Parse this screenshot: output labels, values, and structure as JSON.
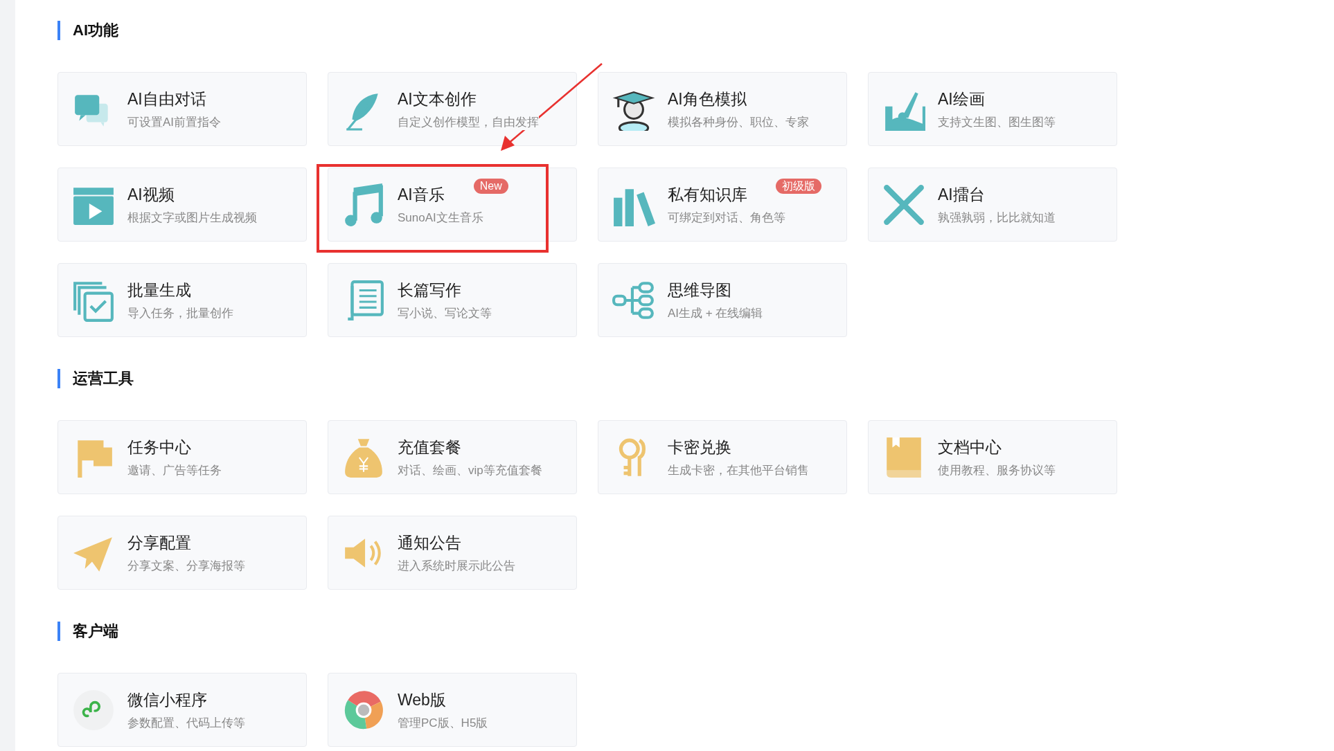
{
  "sections": [
    {
      "title": "AI功能",
      "items": [
        {
          "title": "AI自由对话",
          "desc": "可设置AI前置指令",
          "highlighted": false
        },
        {
          "title": "AI文本创作",
          "desc": "自定义创作模型，自由发挥",
          "highlighted": false
        },
        {
          "title": "AI角色模拟",
          "desc": "模拟各种身份、职位、专家",
          "highlighted": false
        },
        {
          "title": "AI绘画",
          "desc": "支持文生图、图生图等",
          "highlighted": false
        },
        {
          "title": "AI视频",
          "desc": "根据文字或图片生成视频",
          "highlighted": false
        },
        {
          "title": "AI音乐",
          "desc": "SunoAI文生音乐",
          "badge": "New",
          "highlighted": true
        },
        {
          "title": "私有知识库",
          "desc": "可绑定到对话、角色等",
          "badge": "初级版",
          "highlighted": false
        },
        {
          "title": "AI擂台",
          "desc": "孰强孰弱，比比就知道",
          "highlighted": false
        },
        {
          "title": "批量生成",
          "desc": "导入任务，批量创作",
          "highlighted": false
        },
        {
          "title": "长篇写作",
          "desc": "写小说、写论文等",
          "highlighted": false
        },
        {
          "title": "思维导图",
          "desc": "AI生成 + 在线编辑",
          "highlighted": false
        }
      ]
    },
    {
      "title": "运营工具",
      "items": [
        {
          "title": "任务中心",
          "desc": "邀请、广告等任务",
          "highlighted": false
        },
        {
          "title": "充值套餐",
          "desc": "对话、绘画、vip等充值套餐",
          "highlighted": false
        },
        {
          "title": "卡密兑换",
          "desc": "生成卡密，在其他平台销售",
          "highlighted": false
        },
        {
          "title": "文档中心",
          "desc": "使用教程、服务协议等",
          "highlighted": false
        },
        {
          "title": "分享配置",
          "desc": "分享文案、分享海报等",
          "highlighted": false
        },
        {
          "title": "通知公告",
          "desc": "进入系统时展示此公告",
          "highlighted": false
        }
      ]
    },
    {
      "title": "客户端",
      "items": [
        {
          "title": "微信小程序",
          "desc": "参数配置、代码上传等",
          "highlighted": false
        },
        {
          "title": "Web版",
          "desc": "管理PC版、H5版",
          "highlighted": false
        }
      ]
    }
  ]
}
